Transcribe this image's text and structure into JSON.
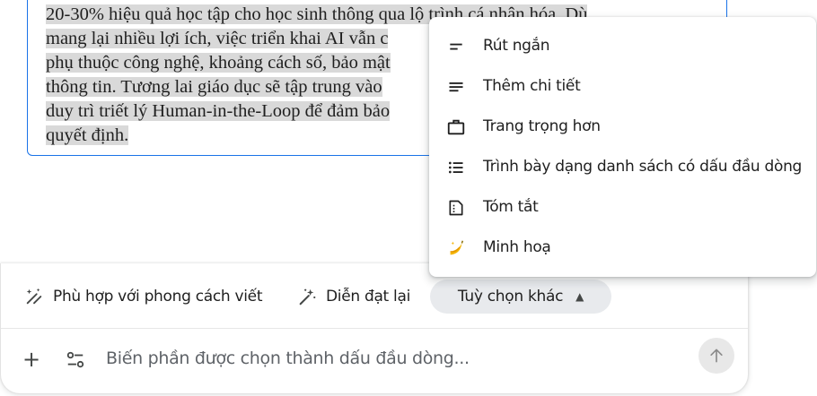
{
  "document": {
    "lines": [
      "20-30% hiệu quả học tập cho học sinh thông qua lộ trình cá nhân hóa. Dù",
      "mang lại nhiều lợi ích, việc triển khai AI vẫn c",
      "phụ thuộc công nghệ, khoảng cách số, bảo mật",
      "thông tin. Tương lai giáo dục sẽ tập trung vào",
      "duy trì triết lý Human-in-the-Loop để đảm bảo",
      "quyết định."
    ]
  },
  "menu": {
    "items": [
      {
        "label": "Rút ngắn",
        "icon": "short-text-icon"
      },
      {
        "label": "Thêm chi tiết",
        "icon": "notes-icon"
      },
      {
        "label": "Trang trọng hơn",
        "icon": "briefcase-icon"
      },
      {
        "label": "Trình bày dạng danh sách có dấu đầu dòng",
        "icon": "bulleted-list-icon"
      },
      {
        "label": "Tóm tắt",
        "icon": "summary-icon"
      },
      {
        "label": "Minh hoạ",
        "icon": "banana-icon"
      }
    ]
  },
  "toolbar": {
    "match_style_label": "Phù hợp với phong cách viết",
    "rephrase_label": "Diễn đạt lại",
    "more_options_label": "Tuỳ chọn khác"
  },
  "input": {
    "prompt_text": "Biến phần được chọn thành dấu đầu dòng..."
  },
  "colors": {
    "accent": "#1a73e8",
    "chip_bg": "#e8eaed",
    "highlight": "#d9d9d9"
  }
}
